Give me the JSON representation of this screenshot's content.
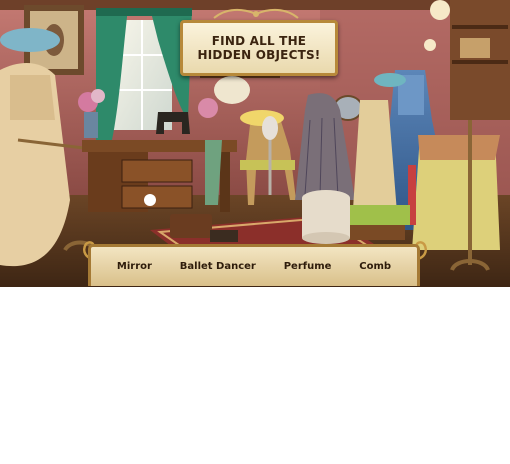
{
  "banner": {
    "line1": "FIND ALL THE",
    "line2": "HIDDEN OBJECTS!"
  },
  "objects": [
    {
      "label": "Mirror"
    },
    {
      "label": "Ballet Dancer"
    },
    {
      "label": "Perfume"
    },
    {
      "label": "Comb"
    }
  ],
  "icons": [
    "scroll-ornament-icon",
    "corner-ornament-icon"
  ],
  "colors": {
    "wall": "#b86a66",
    "curtain": "#2e8a6a",
    "panel": "#eedfb8",
    "frame_gold": "#b7893a",
    "text_dark": "#3b2410"
  }
}
